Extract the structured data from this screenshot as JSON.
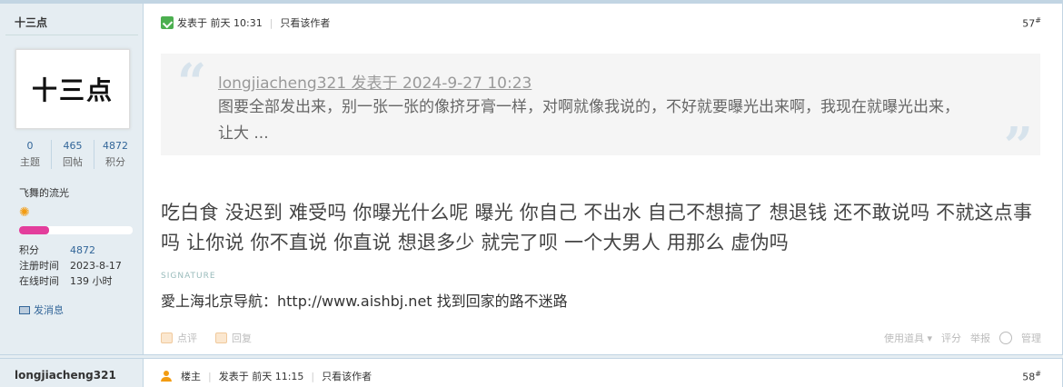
{
  "post1": {
    "author": "十三点",
    "avatar_text": "十三点",
    "stats": [
      {
        "num": "0",
        "label": "主题"
      },
      {
        "num": "465",
        "label": "回帖"
      },
      {
        "num": "4872",
        "label": "积分"
      }
    ],
    "group": "飞舞的流光",
    "level_icon": "sun-icon",
    "progress": 0.26,
    "info": {
      "points_k": "积分",
      "points_v": "4872",
      "reg_k": "注册时间",
      "reg_v": "2023-8-17",
      "online_k": "在线时间",
      "online_v": "139 小时"
    },
    "send_message": "发消息",
    "posted": "发表于 前天 10:31",
    "only_author": "只看该作者",
    "floor": "57",
    "floor_mark": "#",
    "quote_author": "longjiacheng321 发表于 2024-9-27 10:23",
    "quote_text": "图要全部发出来，别一张一张的像挤牙膏一样，对啊就像我说的，不好就要曝光出来啊，我现在就曝光出来，让大 ...",
    "body": "吃白食 没迟到  难受吗  你曝光什么呢  曝光  你自己 不出水  自己不想搞了  想退钱  还不敢说吗  不就这点事吗  让你说  你不直说   你直说 想退多少  就完了呗   一个大男人  用那么 虚伪吗",
    "signature_label": "SIGNATURE",
    "signature": "愛上海北京导航：http://www.aishbj.net 找到回家的路不迷路",
    "comment": "点评",
    "reply": "回复",
    "use_tool": "使用道具",
    "rate": "评分",
    "report": "举报",
    "manage": "管理"
  },
  "post2": {
    "author": "longjiacheng321",
    "role": "楼主",
    "posted": "发表于 前天 11:15",
    "only_author": "只看该作者",
    "floor": "58",
    "floor_mark": "#"
  }
}
